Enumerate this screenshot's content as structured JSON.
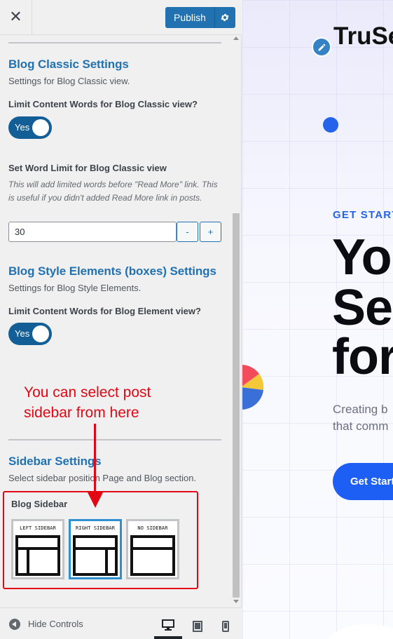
{
  "header": {
    "close_glyph": "✕",
    "publish_label": "Publish",
    "gear_icon": "gear-icon"
  },
  "classic": {
    "title": "Blog Classic Settings",
    "desc": "Settings for Blog Classic view.",
    "limit_label": "Limit Content Words for Blog Classic view?",
    "toggle_label": "Yes",
    "word_label": "Set Word Limit for Blog Classic view",
    "word_desc": "This will add limited words before \"Read More\" link. This is useful if you didn't added Read More link in posts.",
    "word_value": "30",
    "minus": "-",
    "plus": "+"
  },
  "elements": {
    "title": "Blog Style Elements (boxes) Settings",
    "desc": "Settings for Blog Style Elements.",
    "limit_label": "Limit Content Words for Blog Element view?",
    "toggle_label": "Yes"
  },
  "annotation": {
    "line1": "You can select post",
    "line2": "sidebar from here",
    "color": "#e30613"
  },
  "sidebar": {
    "title": "Sidebar Settings",
    "desc": "Select sidebar position Page and Blog section.",
    "blog_label": "Blog Sidebar",
    "options": [
      {
        "label": "LEFT SIDEBAR",
        "selected": false
      },
      {
        "label": "RIGHT SIDEBAR",
        "selected": true
      },
      {
        "label": "NO SIDEBAR",
        "selected": false
      }
    ]
  },
  "footer": {
    "hide_label": "Hide Controls",
    "devices": [
      "desktop-icon",
      "tablet-icon",
      "mobile-icon"
    ]
  },
  "preview": {
    "brand": "TruSe",
    "eyebrow": "GET START",
    "hero": [
      "Yo",
      "Se",
      "for"
    ],
    "sub": [
      "Creating b",
      "that comm"
    ],
    "cta": "Get Start",
    "accent": "#1d5ff5"
  },
  "colors": {
    "wp_blue": "#2271b1",
    "toggle_on": "#135e96",
    "panel_bg": "#f0f0f1"
  }
}
